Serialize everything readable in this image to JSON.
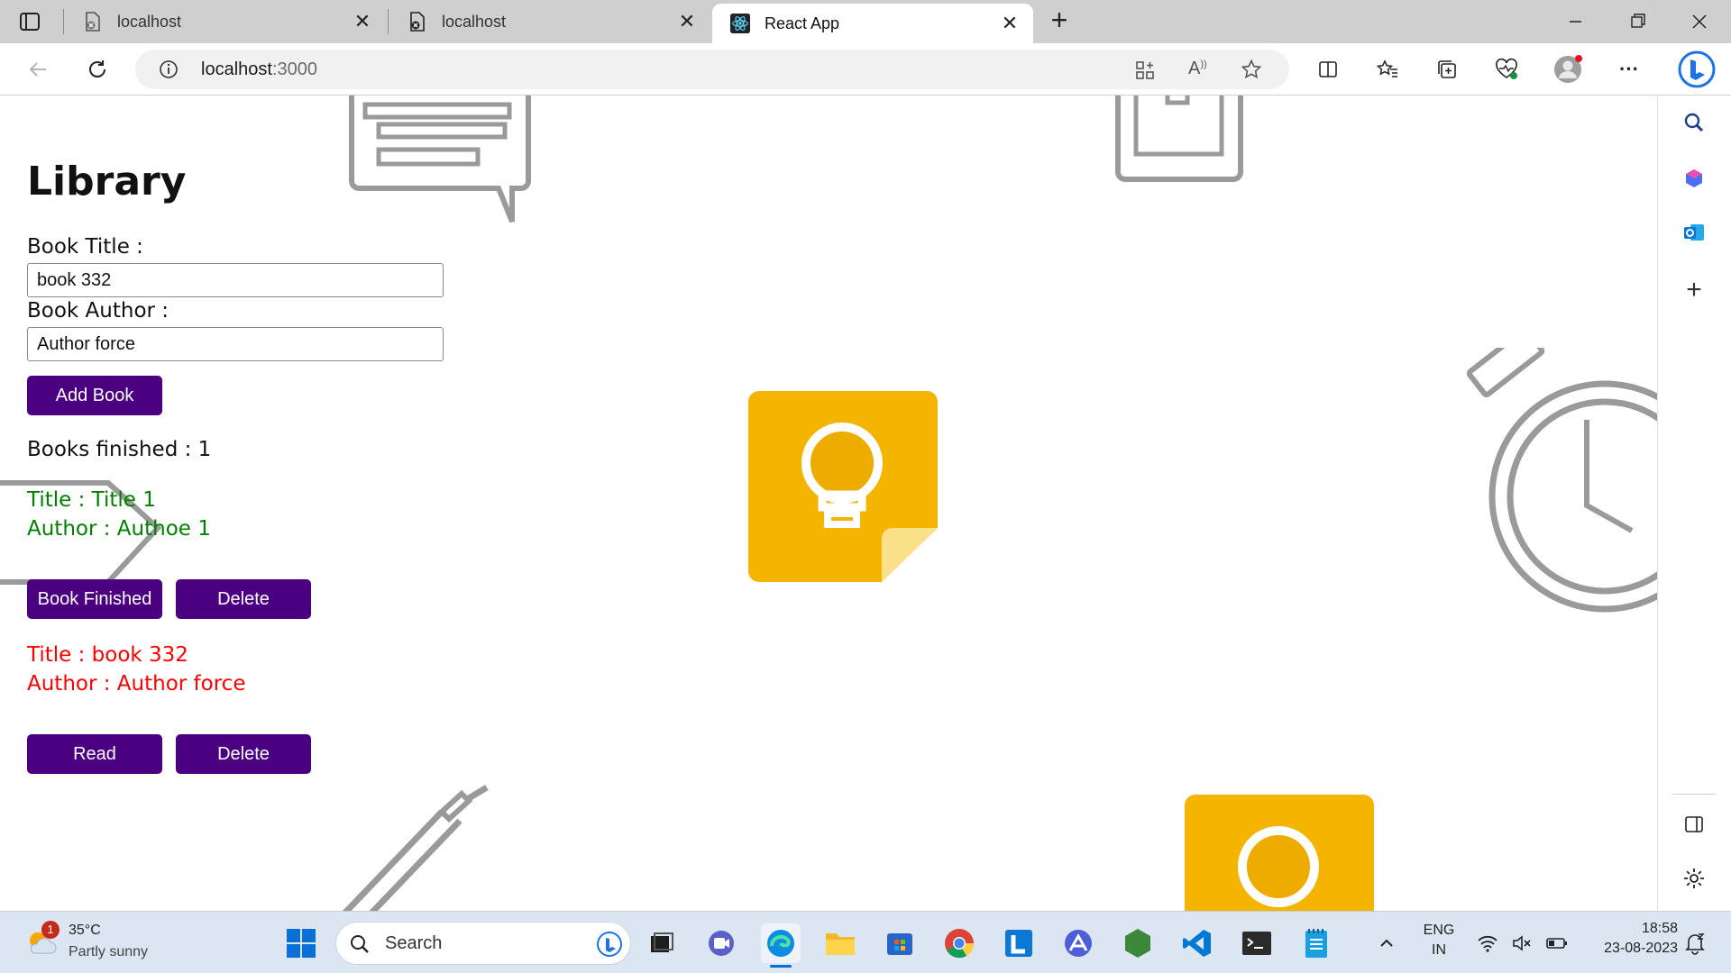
{
  "browser": {
    "tabs": [
      {
        "title": "localhost",
        "icon": "broken-page-icon"
      },
      {
        "title": "localhost",
        "icon": "broken-page-icon"
      },
      {
        "title": "React App",
        "icon": "react-icon",
        "active": true
      }
    ],
    "address": {
      "host": "localhost",
      "port": ":3000"
    }
  },
  "app": {
    "heading": "Library",
    "title_label": "Book Title :",
    "title_value": "book 332",
    "author_label": "Book Author :",
    "author_value": "Author force",
    "add_button": "Add Book",
    "finished_count": "Books finished : 1",
    "books": [
      {
        "title": "Title : Title 1",
        "author": "Author : Authoe 1",
        "color": "#008000",
        "primary_button": "Book Finished",
        "delete_button": "Delete"
      },
      {
        "title": "Title : book 332",
        "author": "Author : Author force",
        "color": "#ff0000",
        "primary_button": "Read",
        "delete_button": "Delete"
      }
    ],
    "accent": "#4a0080"
  },
  "taskbar": {
    "weather_temp": "35°C",
    "weather_desc": "Partly sunny",
    "weather_badge": "1",
    "search_placeholder": "Search",
    "lang_top": "ENG",
    "lang_bottom": "IN",
    "time": "18:58",
    "date": "23-08-2023"
  }
}
